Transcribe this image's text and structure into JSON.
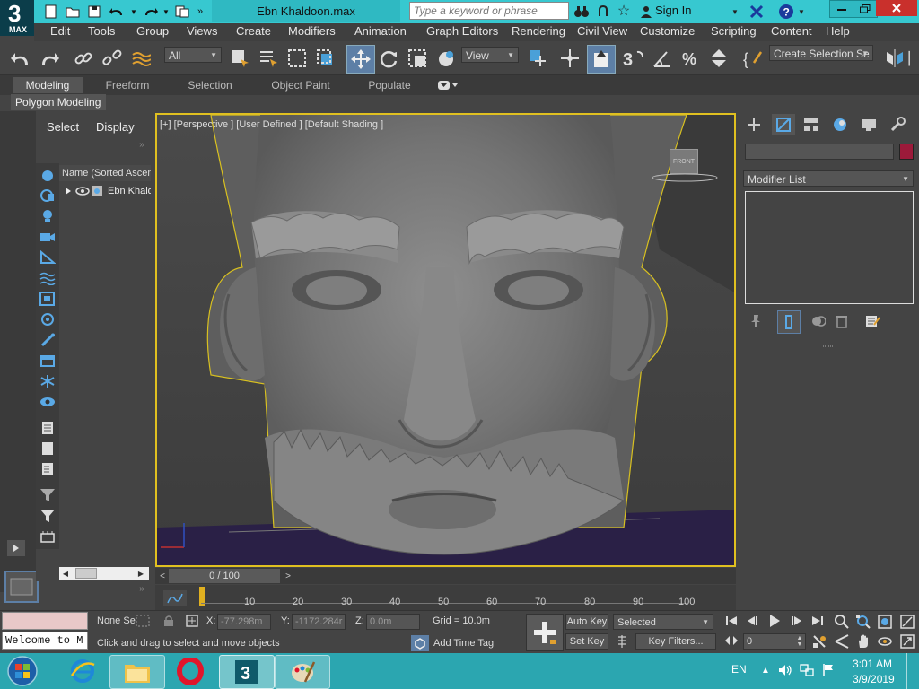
{
  "app": {
    "logo_text": "3",
    "logo_sub": "MAX",
    "window_title": "Ebn Khaldoon.max",
    "search_placeholder": "Type a keyword or phrase",
    "sign_in": "Sign In"
  },
  "menu": [
    "Edit",
    "Tools",
    "Group",
    "Views",
    "Create",
    "Modifiers",
    "Animation",
    "Graph Editors",
    "Rendering",
    "Civil View",
    "Customize",
    "Scripting",
    "Content",
    "Help"
  ],
  "toolbar": {
    "selection_filter": "All",
    "reference_coord": "View",
    "named_selection": "Create Selection Se"
  },
  "ribbon": {
    "tabs": [
      "Modeling",
      "Freeform",
      "Selection",
      "Object Paint",
      "Populate"
    ],
    "active_tab": "Modeling",
    "sub_panel": "Polygon Modeling"
  },
  "scene_explorer": {
    "tabs": [
      "Select",
      "Display"
    ],
    "column_header": "Name (Sorted Ascen",
    "rows": [
      "Ebn Khaldo"
    ]
  },
  "viewport": {
    "label": "[+] [Perspective ] [User Defined ] [Default Shading ]",
    "viewcube_face": "FRONT",
    "accent_color": "#e0c020"
  },
  "command_panel": {
    "modifier_list": "Modifier List",
    "object_color": "#9c1a3a"
  },
  "timeline": {
    "frame_display": "0 / 100",
    "ticks": [
      "10",
      "20",
      "30",
      "40",
      "50",
      "60",
      "70",
      "80",
      "90",
      "100"
    ],
    "current_frame": 0
  },
  "status": {
    "selection": "None Se",
    "x_label": "X:",
    "x_value": "-77.298m",
    "y_label": "Y:",
    "y_value": "-1172.284r",
    "z_label": "Z:",
    "z_value": "0.0m",
    "grid": "Grid = 10.0m",
    "prompt": "Click and drag to select and move objects",
    "welcome": "Welcome to M",
    "add_time_tag": "Add Time Tag",
    "auto_key": "Auto Key",
    "set_key": "Set Key",
    "key_mode": "Selected",
    "key_filters": "Key Filters...",
    "frame_field": "0"
  },
  "taskbar": {
    "language": "EN",
    "time": "3:01 AM",
    "date": "3/9/2019"
  }
}
